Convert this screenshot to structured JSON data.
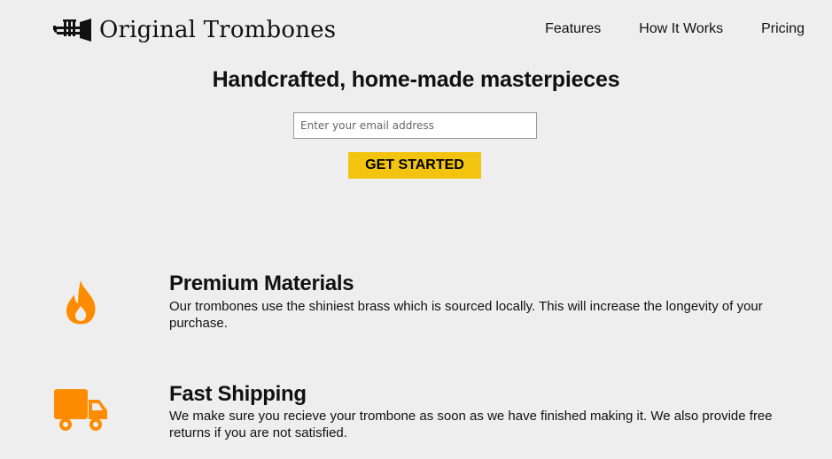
{
  "header": {
    "logo_text": "Original Trombones",
    "logo_icon": "trumpet-icon",
    "nav": [
      {
        "label": "Features"
      },
      {
        "label": "How It Works"
      },
      {
        "label": "Pricing"
      }
    ]
  },
  "hero": {
    "title": "Handcrafted, home-made masterpieces",
    "email_placeholder": "Enter your email address",
    "email_value": "",
    "cta_label": "GET STARTED"
  },
  "features": [
    {
      "icon": "fire-icon",
      "title": "Premium Materials",
      "description": "Our trombones use the shiniest brass which is sourced locally. This will increase the longevity of your purchase."
    },
    {
      "icon": "truck-icon",
      "title": "Fast Shipping",
      "description": "We make sure you recieve your trombone as soon as we have finished making it. We also provide free returns if you are not satisfied."
    }
  ],
  "colors": {
    "background": "#eeeeee",
    "accent_button": "#f2c40f",
    "icon_orange": "#ff8c00"
  }
}
